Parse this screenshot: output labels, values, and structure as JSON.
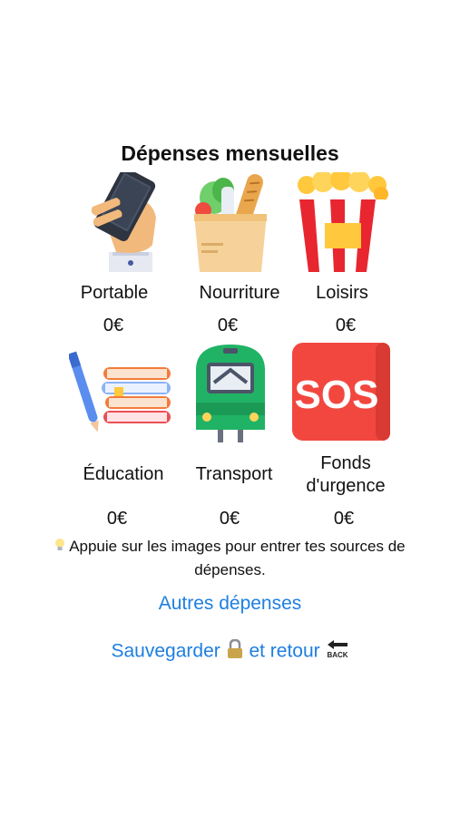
{
  "page_title": "Dépenses mensuelles",
  "categories": [
    {
      "label": "Portable",
      "amount": "0€",
      "icon": "smartphone-hand-icon"
    },
    {
      "label": "Nourriture",
      "amount": "0€",
      "icon": "grocery-bag-icon"
    },
    {
      "label": "Loisirs",
      "amount": "0€",
      "icon": "popcorn-icon"
    },
    {
      "label": "Éducation",
      "amount": "0€",
      "icon": "books-pen-icon"
    },
    {
      "label": "Transport",
      "amount": "0€",
      "icon": "train-icon"
    },
    {
      "label": "Fonds d'urgence",
      "amount": "0€",
      "icon": "sos-icon",
      "icon_text": "SOS"
    }
  ],
  "hint": {
    "icon": "lightbulb-icon",
    "text": "Appuie sur les images pour entrer tes sources de dépenses."
  },
  "other_expenses_link": "Autres dépenses",
  "save_link": {
    "label_part1": "Sauvegarder",
    "label_part2": "et retour",
    "lock_icon": "lock-icon",
    "back_icon": "back-arrow-icon",
    "back_text": "BACK"
  },
  "colors": {
    "link": "#1e7fe0",
    "sos_red": "#f2473f",
    "train_green": "#21b365",
    "popcorn_red": "#e8262f",
    "popcorn_yellow": "#ffc83d"
  }
}
